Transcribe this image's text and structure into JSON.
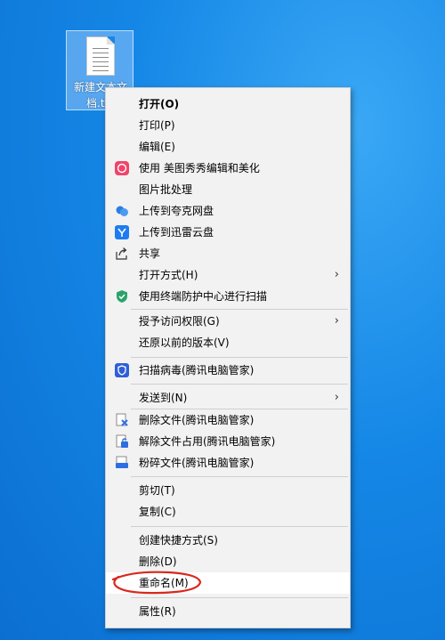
{
  "desktop": {
    "icon_label_line1": "新建文本文",
    "icon_label_line2": "档.t..."
  },
  "menu": {
    "items": [
      {
        "label": "打开(O)"
      },
      {
        "label": "打印(P)"
      },
      {
        "label": "编辑(E)"
      },
      {
        "label": "使用 美图秀秀编辑和美化",
        "icon": "meitu-icon"
      },
      {
        "label": "图片批处理"
      },
      {
        "label": "上传到夸克网盘",
        "icon": "quark-cloud-icon"
      },
      {
        "label": "上传到迅雷云盘",
        "icon": "xunlei-icon"
      },
      {
        "label": "共享",
        "icon": "share-icon"
      },
      {
        "label": "打开方式(H)"
      },
      {
        "label": "使用终端防护中心进行扫描",
        "icon": "shield-scan-icon"
      },
      {
        "label": "授予访问权限(G)"
      },
      {
        "label": "还原以前的版本(V)"
      },
      {
        "label": "扫描病毒(腾讯电脑管家)",
        "icon": "tencent-shield-icon"
      },
      {
        "label": "发送到(N)"
      },
      {
        "label": "删除文件(腾讯电脑管家)",
        "icon": "delete-file-icon"
      },
      {
        "label": "解除文件占用(腾讯电脑管家)",
        "icon": "unlock-file-icon"
      },
      {
        "label": "粉碎文件(腾讯电脑管家)",
        "icon": "shred-file-icon"
      },
      {
        "label": "剪切(T)"
      },
      {
        "label": "复制(C)"
      },
      {
        "label": "创建快捷方式(S)"
      },
      {
        "label": "删除(D)"
      },
      {
        "label": "重命名(M)"
      },
      {
        "label": "属性(R)"
      }
    ],
    "submenu_arrow": "›",
    "highlighted": "重命名(M)"
  },
  "colors": {
    "annotation_circle": "#d9281c",
    "desktop_background": "#1587e6"
  }
}
